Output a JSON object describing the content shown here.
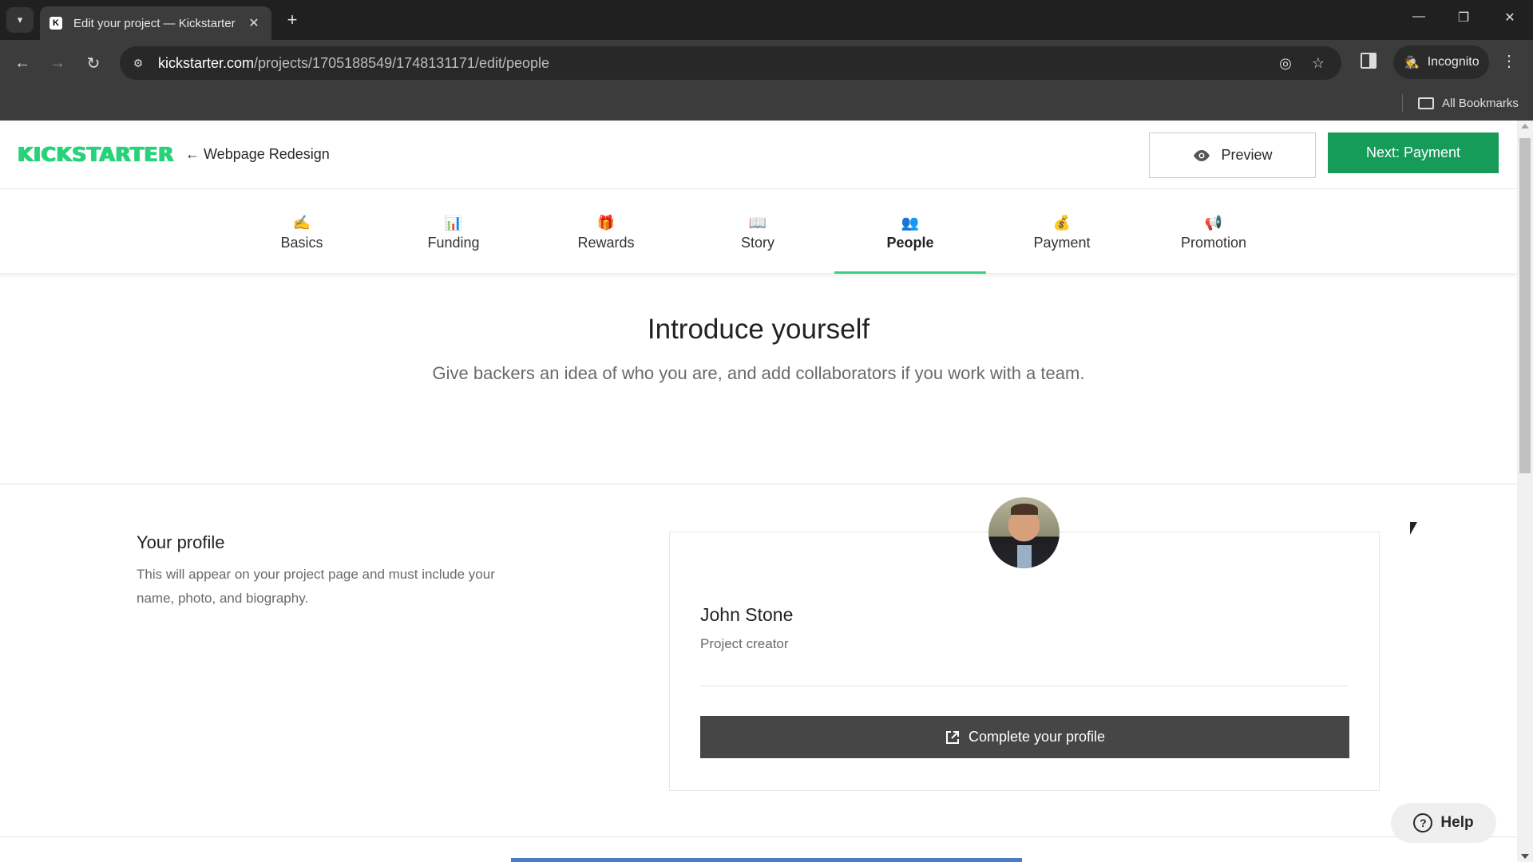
{
  "browser": {
    "tab_title": "Edit your project — Kickstarter",
    "favicon_letter": "K",
    "url_host": "kickstarter.com",
    "url_path": "/projects/1705188549/1748131171/edit/people",
    "profile_label": "Incognito",
    "bookmarks_label": "All Bookmarks",
    "icons": {
      "tab_list": "▾",
      "close": "✕",
      "new_tab": "+",
      "minimize": "—",
      "restore": "❐",
      "window_close": "✕",
      "back": "←",
      "forward": "→",
      "reload": "↻",
      "site_info": "⚙",
      "eye_off": "◎",
      "star": "☆",
      "menu": "⋮",
      "incognito": "🕵",
      "folder": "🗀"
    }
  },
  "header": {
    "logo": "KICKSTARTER",
    "back_arrow": "←",
    "project_name": "Webpage Redesign",
    "preview_label": "Preview",
    "next_label": "Next: Payment"
  },
  "steps": [
    {
      "label": "Basics",
      "icon": "✍",
      "active": false
    },
    {
      "label": "Funding",
      "icon": "📊",
      "active": false
    },
    {
      "label": "Rewards",
      "icon": "🎁",
      "active": false
    },
    {
      "label": "Story",
      "icon": "📖",
      "active": false
    },
    {
      "label": "People",
      "icon": "👥",
      "active": true
    },
    {
      "label": "Payment",
      "icon": "💰",
      "active": false
    },
    {
      "label": "Promotion",
      "icon": "📢",
      "active": false
    }
  ],
  "intro": {
    "title": "Introduce yourself",
    "subtitle": "Give backers an idea of who you are, and add collaborators if you work with a team."
  },
  "profile": {
    "heading": "Your profile",
    "description": "This will appear on your project page and must include your name, photo, and biography.",
    "name": "John Stone",
    "role": "Project creator",
    "complete_label": "Complete your profile",
    "complete_icon": "↗"
  },
  "help": {
    "label": "Help",
    "icon": "?"
  },
  "colors": {
    "brand_green": "#28d27a",
    "primary_button": "#169b59",
    "active_tab_underline": "#37d186",
    "dark_button": "#464646"
  }
}
